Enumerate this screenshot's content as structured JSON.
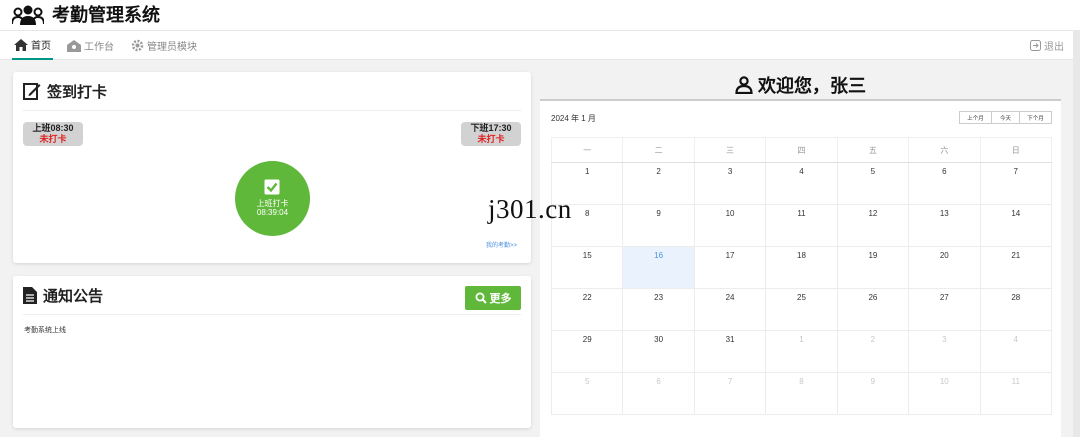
{
  "app": {
    "title": "考勤管理系统"
  },
  "nav": {
    "items": [
      {
        "label": "首页",
        "icon": "home-icon",
        "active": true
      },
      {
        "label": "工作台",
        "icon": "workbench-icon",
        "active": false
      },
      {
        "label": "管理员模块",
        "icon": "gear-icon",
        "active": false
      }
    ],
    "logout": "退出"
  },
  "checkin": {
    "title": "签到打卡",
    "on_duty": {
      "label": "上班08:30",
      "status": "未打卡"
    },
    "off_duty": {
      "label": "下班17:30",
      "status": "未打卡"
    },
    "button_label": "上班打卡",
    "button_time": "08:39:04",
    "my_attendance_link": "我的考勤>>"
  },
  "notice": {
    "title": "通知公告",
    "more_label": "更多",
    "items": [
      "考勤系统上线"
    ]
  },
  "welcome": {
    "text": "欢迎您，张三"
  },
  "calendar": {
    "title": "2024 年 1 月",
    "buttons": {
      "prev": "上个月",
      "today": "今天",
      "next": "下个月"
    },
    "weekdays": [
      "一",
      "二",
      "三",
      "四",
      "五",
      "六",
      "日"
    ],
    "weeks": [
      [
        {
          "d": "1"
        },
        {
          "d": "2"
        },
        {
          "d": "3"
        },
        {
          "d": "4"
        },
        {
          "d": "5"
        },
        {
          "d": "6"
        },
        {
          "d": "7"
        }
      ],
      [
        {
          "d": "8"
        },
        {
          "d": "9"
        },
        {
          "d": "10"
        },
        {
          "d": "11"
        },
        {
          "d": "12"
        },
        {
          "d": "13"
        },
        {
          "d": "14"
        }
      ],
      [
        {
          "d": "15"
        },
        {
          "d": "16",
          "today": true
        },
        {
          "d": "17"
        },
        {
          "d": "18"
        },
        {
          "d": "19"
        },
        {
          "d": "20"
        },
        {
          "d": "21"
        }
      ],
      [
        {
          "d": "22"
        },
        {
          "d": "23"
        },
        {
          "d": "24"
        },
        {
          "d": "25"
        },
        {
          "d": "26"
        },
        {
          "d": "27"
        },
        {
          "d": "28"
        }
      ],
      [
        {
          "d": "29"
        },
        {
          "d": "30"
        },
        {
          "d": "31"
        },
        {
          "d": "1",
          "other": true
        },
        {
          "d": "2",
          "other": true
        },
        {
          "d": "3",
          "other": true
        },
        {
          "d": "4",
          "other": true
        }
      ],
      [
        {
          "d": "5",
          "other": true
        },
        {
          "d": "6",
          "other": true
        },
        {
          "d": "7",
          "other": true
        },
        {
          "d": "8",
          "other": true
        },
        {
          "d": "9",
          "other": true
        },
        {
          "d": "10",
          "other": true
        },
        {
          "d": "11",
          "other": true
        }
      ]
    ]
  },
  "watermark": "j301.cn",
  "colors": {
    "accent_green": "#5fb83a",
    "tab_underline": "#009688",
    "warning_red": "#e02020",
    "link_blue": "#4a90e2",
    "today_bg": "#eaf3fd"
  }
}
